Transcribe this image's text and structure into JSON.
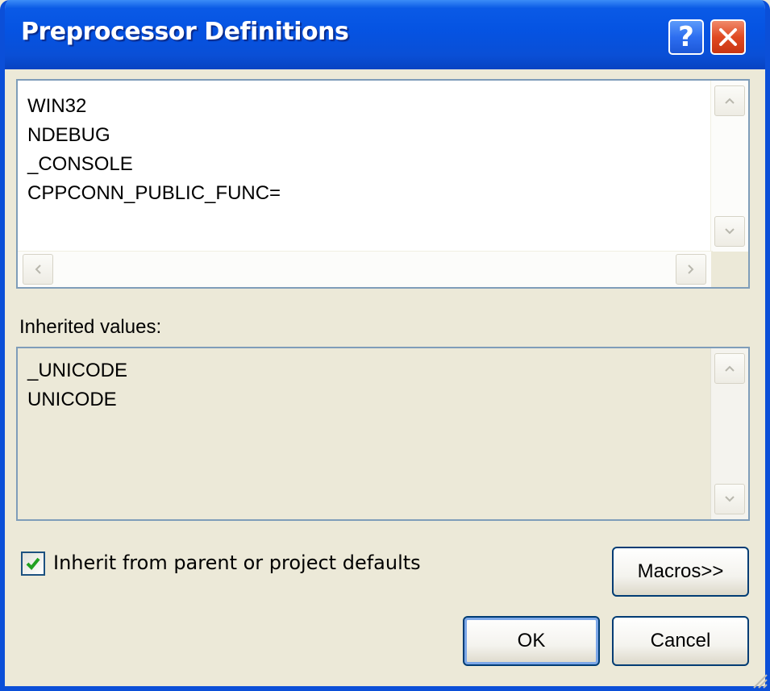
{
  "window": {
    "title": "Preprocessor Definitions"
  },
  "titlebar_buttons": {
    "help_glyph": "?"
  },
  "definitions": {
    "lines": [
      "WIN32",
      "NDEBUG",
      "_CONSOLE",
      "CPPCONN_PUBLIC_FUNC="
    ]
  },
  "inherited": {
    "label": "Inherited values:",
    "lines": [
      "_UNICODE",
      "UNICODE"
    ]
  },
  "inherit_checkbox": {
    "label": "Inherit from parent or project defaults",
    "checked": true
  },
  "buttons": {
    "macros": "Macros>>",
    "ok": "OK",
    "cancel": "Cancel"
  },
  "colors": {
    "titlebar": "#0553e2",
    "face": "#ece9d8",
    "check": "#21a121"
  }
}
